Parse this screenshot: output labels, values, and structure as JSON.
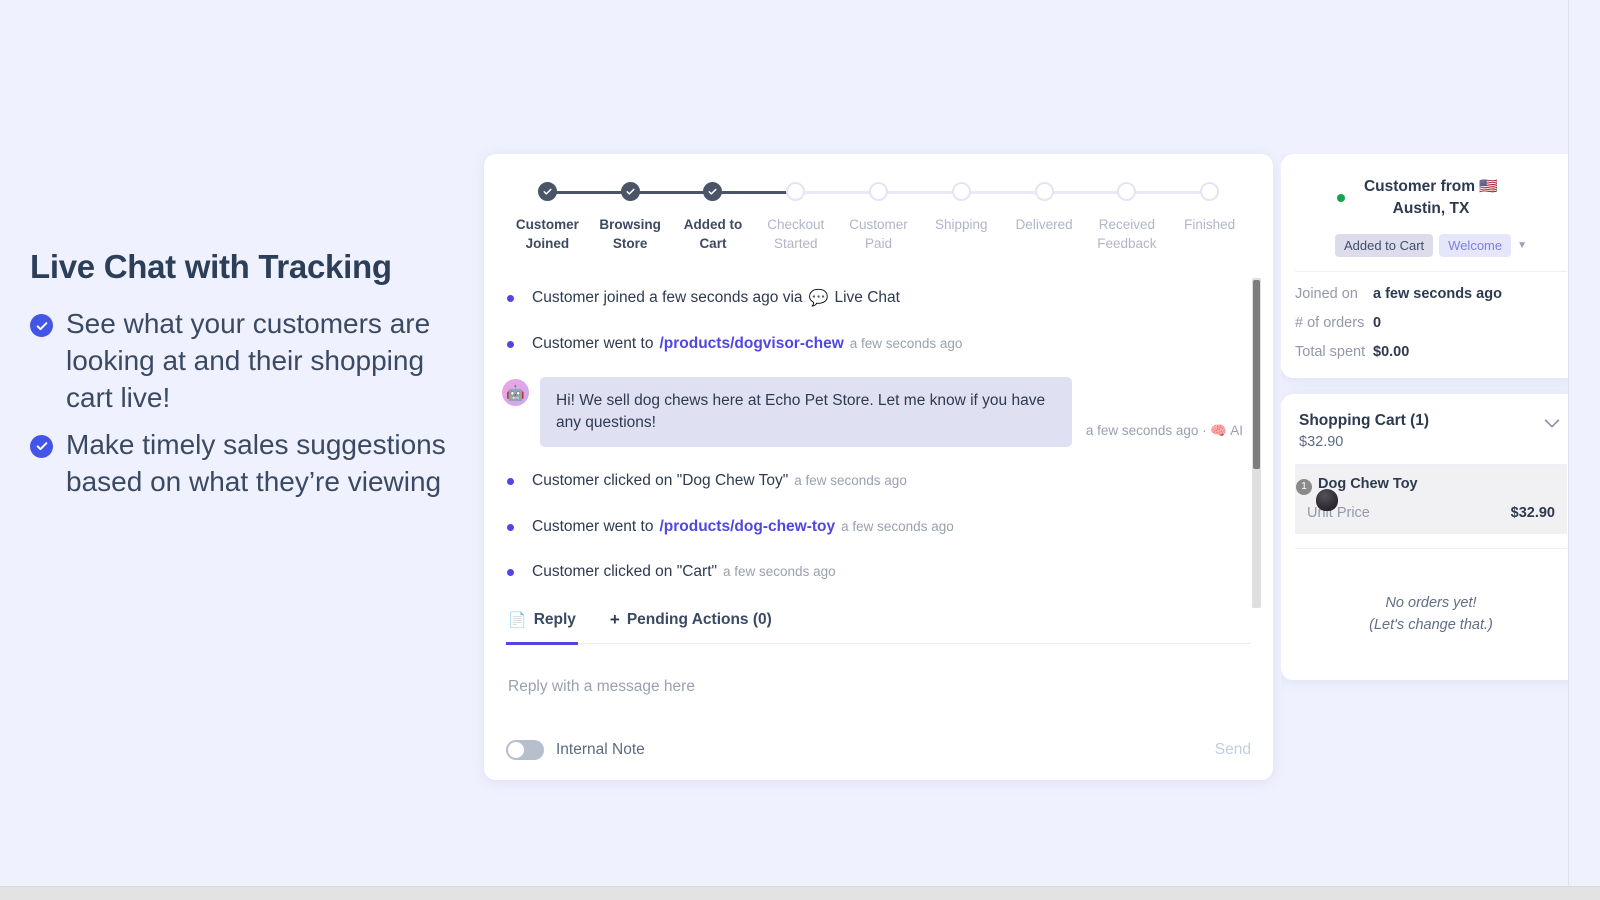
{
  "marketing": {
    "heading": "Live Chat with Tracking",
    "bullets": [
      "See what your customers are looking at and their shopping cart live!",
      "Make timely sales suggestions based on what they’re viewing"
    ]
  },
  "stepper": {
    "steps": [
      {
        "label": "Customer Joined",
        "state": "done"
      },
      {
        "label": "Browsing Store",
        "state": "done"
      },
      {
        "label": "Added to Cart",
        "state": "done"
      },
      {
        "label": "Checkout Started",
        "state": "pending"
      },
      {
        "label": "Customer Paid",
        "state": "pending"
      },
      {
        "label": "Shipping",
        "state": "pending"
      },
      {
        "label": "Delivered",
        "state": "pending"
      },
      {
        "label": "Received Feedback",
        "state": "pending"
      },
      {
        "label": "Finished",
        "state": "pending"
      }
    ]
  },
  "feed": {
    "events": [
      {
        "text": "Customer joined a few seconds ago via",
        "channel_icon": "speech-bubble-icon",
        "channel": "Live Chat",
        "link": "",
        "time": ""
      },
      {
        "text": "Customer went to",
        "link": "/products/dogvisor-chew",
        "time": "a few seconds ago",
        "channel": ""
      },
      {
        "text": "Customer clicked on \"Dog Chew Toy\"",
        "link": "",
        "time": "a few seconds ago",
        "channel": ""
      },
      {
        "text": "Customer went to",
        "link": "/products/dog-chew-toy",
        "time": "a few seconds ago",
        "channel": ""
      },
      {
        "text": "Customer clicked on \"Cart\"",
        "link": "",
        "time": "a few seconds ago",
        "channel": ""
      }
    ],
    "message": {
      "avatar_emoji": "🤖",
      "body": "Hi! We sell dog chews here at Echo Pet Store. Let me know if you have any questions!",
      "meta": "a few seconds ago · 🧠 AI"
    }
  },
  "composer": {
    "tabs": [
      {
        "label": "Reply",
        "icon": "document-icon",
        "active": true
      },
      {
        "label": "Pending Actions (0)",
        "icon": "plus-icon",
        "active": false
      }
    ],
    "placeholder": "Reply with a message here",
    "internal_note_label": "Internal Note",
    "internal_note_on": false,
    "send_label": "Send"
  },
  "customer": {
    "title_line1": "Customer from",
    "flag": "🇺🇸",
    "title_line2": "Austin, TX",
    "online": true,
    "tags": [
      {
        "label": "Added to Cart",
        "style": "added"
      },
      {
        "label": "Welcome",
        "style": "welcome"
      }
    ],
    "details": [
      {
        "key": "Joined on",
        "value": "a few seconds ago"
      },
      {
        "key": "# of orders",
        "value": "0"
      },
      {
        "key": "Total spent",
        "value": "$0.00"
      }
    ]
  },
  "cart": {
    "title": "Shopping Cart (1)",
    "total": "$32.90",
    "items": [
      {
        "name": "Dog Chew Toy",
        "qty": "1",
        "unit_price_label": "Unit Price",
        "unit_price": "$32.90"
      }
    ],
    "no_orders_line1": "No orders yet!",
    "no_orders_line2": "(Let's change that.)"
  },
  "colors": {
    "page_bg": "#eff1fe",
    "accent": "#4f46e5",
    "stepper_done": "#4a5568",
    "stepper_pending": "#e9e9f7",
    "online": "#16a34a"
  }
}
